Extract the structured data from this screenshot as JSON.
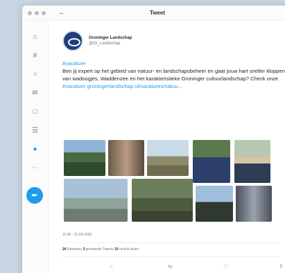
{
  "window": {
    "title": "Tweet",
    "back_icon": "back-arrow-icon"
  },
  "sidebar": {
    "items": [
      {
        "icon": "home-icon"
      },
      {
        "icon": "hashtag-icon"
      },
      {
        "icon": "bell-icon"
      },
      {
        "icon": "mail-icon"
      },
      {
        "icon": "bookmark-icon"
      },
      {
        "icon": "list-icon"
      },
      {
        "icon": "profile-icon",
        "active": true
      },
      {
        "icon": "more-icon"
      }
    ],
    "compose_icon": "feather-icon"
  },
  "tweet": {
    "author_name": "Groninger Landschap",
    "author_handle": "@Gr_Landschap",
    "text_hashtag": "#vacature",
    "text_body": "Ben jij expert op het gebied van natuur- en landschapsbeheer en gaat jouw hart sneller kloppen van wadoogjes, Waddenzee en het karakteristieke Groninger cultuurlandschap? Check onze",
    "text_link1": "#vacature",
    "text_link2": "groningerlandschap.nl/vacatures/natuu...",
    "meta": "11:05 · 21-03-2023",
    "stats": {
      "retweets_count": "24",
      "retweets_label": "Retweets",
      "quotes_count": "3",
      "quotes_label": "geciteerde Tweets",
      "likes_count": "10",
      "likes_label": "vind-ik-leuks"
    },
    "actions": [
      {
        "icon": "reply-icon"
      },
      {
        "icon": "retweet-icon"
      },
      {
        "icon": "like-icon"
      },
      {
        "icon": "share-icon",
        "active": true
      }
    ]
  },
  "colors": {
    "accent": "#1d9bf0",
    "background": "#c9d4e2"
  }
}
